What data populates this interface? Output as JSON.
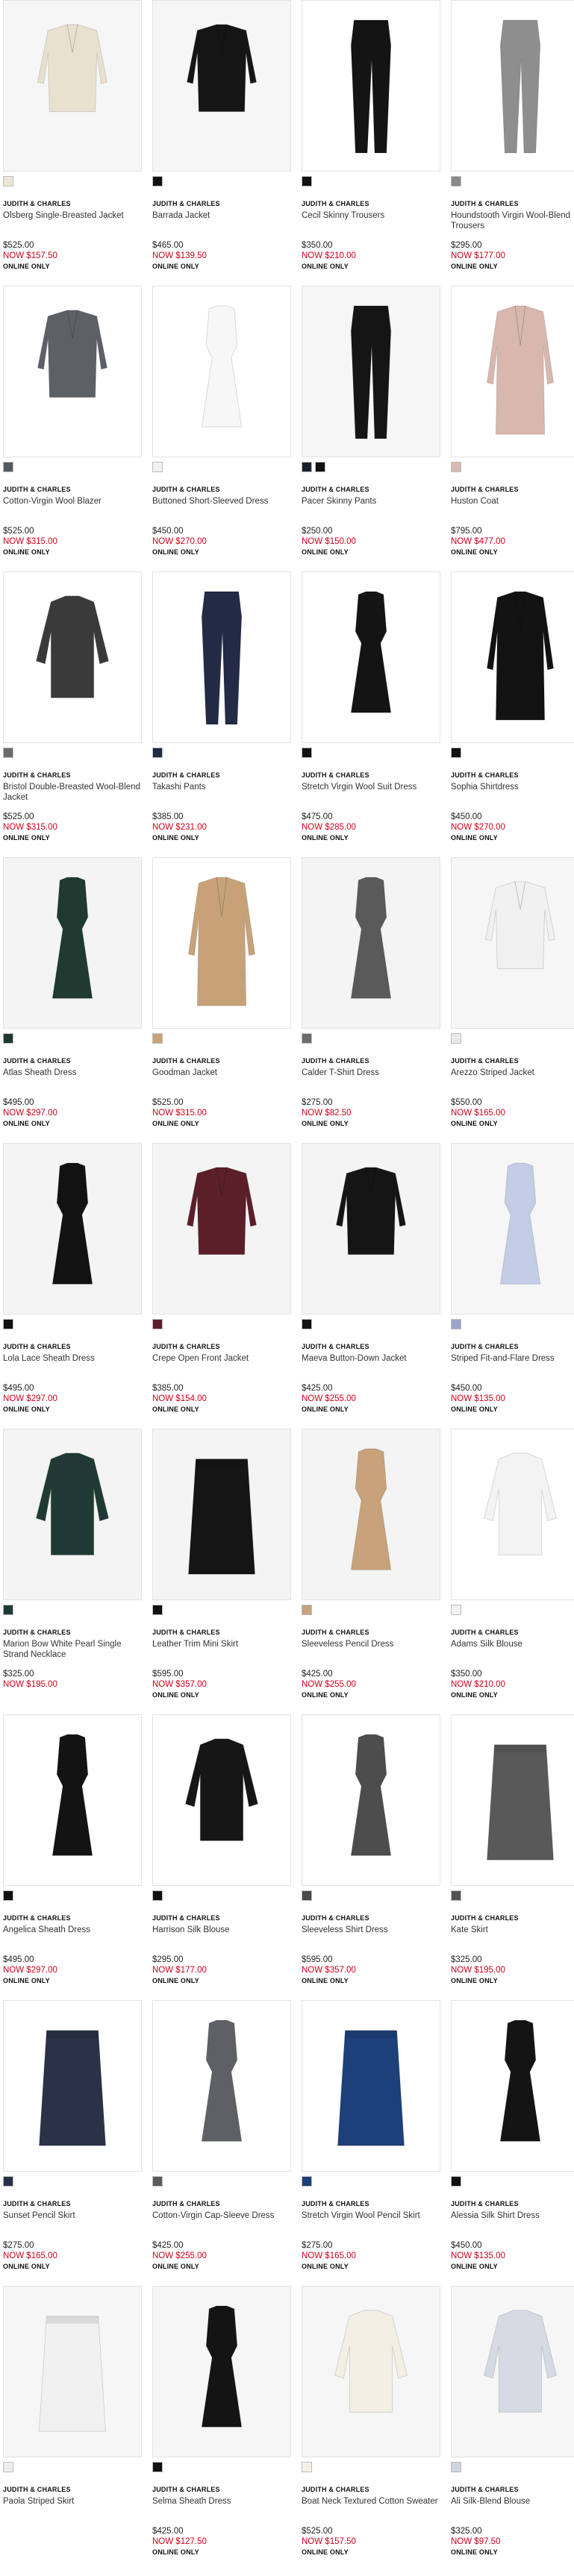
{
  "products": [
    {
      "brand": "JUDITH & CHARLES",
      "name": "Olsberg Single-Breasted Jacket",
      "was": "$525.00",
      "now": "NOW  $157.50",
      "online": "ONLINE ONLY",
      "swatches": [
        "#ece6d4"
      ],
      "garment": "jacket",
      "color": "#e9e1cf",
      "bg": "#f6f6f6"
    },
    {
      "brand": "JUDITH & CHARLES",
      "name": "Barrada Jacket",
      "was": "$465.00",
      "now": "NOW  $139.50",
      "online": "ONLINE ONLY",
      "swatches": [
        "#111111"
      ],
      "garment": "jacket",
      "color": "#151515",
      "bg": "#f6f6f6"
    },
    {
      "brand": "JUDITH & CHARLES",
      "name": "Cecil Skinny Trousers",
      "was": "$350.00",
      "now": "NOW  $210.00",
      "online": "ONLINE ONLY",
      "swatches": [
        "#111111"
      ],
      "garment": "pants",
      "color": "#141414",
      "bg": "#ffffff"
    },
    {
      "brand": "JUDITH & CHARLES",
      "name": "Houndstooth Virgin Wool-Blend Trousers",
      "was": "$295.00",
      "now": "NOW  $177.00",
      "online": "ONLINE ONLY",
      "swatches": [
        "#8a8a8a"
      ],
      "garment": "pants",
      "color": "#8e8e8e",
      "bg": "#ffffff"
    },
    {
      "brand": "JUDITH & CHARLES",
      "name": "Cotton-Virgin Wool Blazer",
      "was": "$525.00",
      "now": "NOW  $315.00",
      "online": "ONLINE ONLY",
      "swatches": [
        "#55595e"
      ],
      "garment": "jacket",
      "color": "#5d6167",
      "bg": "#ffffff"
    },
    {
      "brand": "JUDITH & CHARLES",
      "name": "Buttoned Short-Sleeved Dress",
      "was": "$450.00",
      "now": "NOW  $270.00",
      "online": "ONLINE ONLY",
      "swatches": [
        "#f2f2f2"
      ],
      "garment": "dress",
      "color": "#f7f7f7",
      "bg": "#ffffff"
    },
    {
      "brand": "JUDITH & CHARLES",
      "name": "Pacer Skinny Pants",
      "was": "$250.00",
      "now": "NOW  $150.00",
      "online": "ONLINE ONLY",
      "swatches": [
        "#1a1f2e",
        "#111111"
      ],
      "garment": "pants",
      "color": "#151515",
      "bg": "#f6f6f6"
    },
    {
      "brand": "JUDITH & CHARLES",
      "name": "Huston Coat",
      "was": "$795.00",
      "now": "NOW  $477.00",
      "online": "ONLINE ONLY",
      "swatches": [
        "#d9b9b2"
      ],
      "garment": "coat",
      "color": "#d8b7ae",
      "bg": "#ffffff"
    },
    {
      "brand": "JUDITH & CHARLES",
      "name": "Bristol Double-Breasted Wool-Blend Jacket",
      "was": "$525.00",
      "now": "NOW  $315.00",
      "online": "ONLINE ONLY",
      "swatches": [
        "#6a6a6a"
      ],
      "garment": "top",
      "color": "#3a3a3a",
      "bg": "#ffffff"
    },
    {
      "brand": "JUDITH & CHARLES",
      "name": "Takashi Pants",
      "was": "$385.00",
      "now": "NOW  $231.00",
      "online": "ONLINE ONLY",
      "swatches": [
        "#232a45"
      ],
      "garment": "pants",
      "color": "#232a45",
      "bg": "#ffffff"
    },
    {
      "brand": "JUDITH & CHARLES",
      "name": "Stretch Virgin Wool Suit Dress",
      "was": "$475.00",
      "now": "NOW  $285.00",
      "online": "ONLINE ONLY",
      "swatches": [
        "#111111"
      ],
      "garment": "dress",
      "color": "#141414",
      "bg": "#ffffff"
    },
    {
      "brand": "JUDITH & CHARLES",
      "name": "Sophia Shirtdress",
      "was": "$450.00",
      "now": "NOW  $270.00",
      "online": "ONLINE ONLY",
      "swatches": [
        "#111111"
      ],
      "garment": "coat",
      "color": "#121212",
      "bg": "#ffffff"
    },
    {
      "brand": "JUDITH & CHARLES",
      "name": "Atlas Sheath Dress",
      "was": "$495.00",
      "now": "NOW  $297.00",
      "online": "ONLINE ONLY",
      "swatches": [
        "#1f3a30"
      ],
      "garment": "dress",
      "color": "#1f3a30",
      "bg": "#f4f4f4"
    },
    {
      "brand": "JUDITH & CHARLES",
      "name": "Goodman Jacket",
      "was": "$525.00",
      "now": "NOW  $315.00",
      "online": "ONLINE ONLY",
      "swatches": [
        "#c8a27a"
      ],
      "garment": "coat",
      "color": "#c7a279",
      "bg": "#ffffff"
    },
    {
      "brand": "JUDITH & CHARLES",
      "name": "Calder T-Shirt Dress",
      "was": "$275.00",
      "now": "NOW  $82.50",
      "online": "ONLINE ONLY",
      "swatches": [
        "#6c6c6c"
      ],
      "garment": "dress",
      "color": "#5a5a5a",
      "bg": "#f4f4f4"
    },
    {
      "brand": "JUDITH & CHARLES",
      "name": "Arezzo Striped Jacket",
      "was": "$550.00",
      "now": "NOW  $165.00",
      "online": "ONLINE ONLY",
      "swatches": [
        "#e8e8e8"
      ],
      "garment": "jacket",
      "color": "#f1f1f1",
      "bg": "#f6f6f6"
    },
    {
      "brand": "JUDITH & CHARLES",
      "name": "Lola Lace Sheath Dress",
      "was": "$495.00",
      "now": "NOW  $297.00",
      "online": "ONLINE ONLY",
      "swatches": [
        "#111111"
      ],
      "garment": "dress",
      "color": "#121212",
      "bg": "#f4f4f4"
    },
    {
      "brand": "JUDITH & CHARLES",
      "name": "Crepe Open Front Jacket",
      "was": "$385.00",
      "now": "NOW  $154.00",
      "online": "ONLINE ONLY",
      "swatches": [
        "#5b1f2a"
      ],
      "garment": "jacket",
      "color": "#5b1f2a",
      "bg": "#f4f4f4"
    },
    {
      "brand": "JUDITH & CHARLES",
      "name": "Maeva Button-Down Jacket",
      "was": "$425.00",
      "now": "NOW  $255.00",
      "online": "ONLINE ONLY",
      "swatches": [
        "#111111"
      ],
      "garment": "jacket",
      "color": "#151515",
      "bg": "#f4f4f4"
    },
    {
      "brand": "JUDITH & CHARLES",
      "name": "Striped Fit-and-Flare Dress",
      "was": "$450.00",
      "now": "NOW  $135.00",
      "online": "ONLINE ONLY",
      "swatches": [
        "#9aa6c9"
      ],
      "garment": "dress",
      "color": "#c3cde6",
      "bg": "#f6f6f6"
    },
    {
      "brand": "JUDITH & CHARLES",
      "name": "Marion Bow White Pearl Single Strand Necklace",
      "was": "$325.00",
      "now": "NOW  $195.00",
      "online": "",
      "swatches": [
        "#1f3a34"
      ],
      "garment": "top",
      "color": "#1f3a34",
      "bg": "#f4f4f4"
    },
    {
      "brand": "JUDITH & CHARLES",
      "name": "Leather Trim Mini Skirt",
      "was": "$595.00",
      "now": "NOW  $357.00",
      "online": "ONLINE ONLY",
      "swatches": [
        "#111111"
      ],
      "garment": "skirt",
      "color": "#151515",
      "bg": "#f4f4f4"
    },
    {
      "brand": "JUDITH & CHARLES",
      "name": "Sleeveless Pencil Dress",
      "was": "$425.00",
      "now": "NOW  $255.00",
      "online": "ONLINE ONLY",
      "swatches": [
        "#c8a27a"
      ],
      "garment": "dress",
      "color": "#c8a27a",
      "bg": "#f4f4f4"
    },
    {
      "brand": "JUDITH & CHARLES",
      "name": "Adams Silk Blouse",
      "was": "$350.00",
      "now": "NOW  $210.00",
      "online": "ONLINE ONLY",
      "swatches": [
        "#f2f2f2"
      ],
      "garment": "top",
      "color": "#f3f3f3",
      "bg": "#ffffff"
    },
    {
      "brand": "JUDITH & CHARLES",
      "name": "Angelica Sheath Dress",
      "was": "$495.00",
      "now": "NOW  $297.00",
      "online": "ONLINE ONLY",
      "swatches": [
        "#111111"
      ],
      "garment": "dress",
      "color": "#131313",
      "bg": "#ffffff"
    },
    {
      "brand": "JUDITH & CHARLES",
      "name": "Harrison Silk Blouse",
      "was": "$295.00",
      "now": "NOW  $177.00",
      "online": "ONLINE ONLY",
      "swatches": [
        "#111111"
      ],
      "garment": "top",
      "color": "#161616",
      "bg": "#ffffff"
    },
    {
      "brand": "JUDITH & CHARLES",
      "name": "Sleeveless Shirt Dress",
      "was": "$595.00",
      "now": "NOW  $357.00",
      "online": "ONLINE ONLY",
      "swatches": [
        "#4a4a4a"
      ],
      "garment": "dress",
      "color": "#4d4d4d",
      "bg": "#ffffff"
    },
    {
      "brand": "JUDITH & CHARLES",
      "name": "Kate Skirt",
      "was": "$325.00",
      "now": "NOW  $195.00",
      "online": "ONLINE ONLY",
      "swatches": [
        "#555555"
      ],
      "garment": "skirt",
      "color": "#595959",
      "bg": "#ffffff"
    },
    {
      "brand": "JUDITH & CHARLES",
      "name": "Sunset Pencil Skirt",
      "was": "$275.00",
      "now": "NOW  $165.00",
      "online": "ONLINE ONLY",
      "swatches": [
        "#2a3045"
      ],
      "garment": "skirt",
      "color": "#2b3146",
      "bg": "#ffffff"
    },
    {
      "brand": "JUDITH & CHARLES",
      "name": "Cotton-Virgin Cap-Sleeve Dress",
      "was": "$425.00",
      "now": "NOW  $255.00",
      "online": "ONLINE ONLY",
      "swatches": [
        "#5a5a5a"
      ],
      "garment": "dress",
      "color": "#5e6066",
      "bg": "#ffffff"
    },
    {
      "brand": "JUDITH & CHARLES",
      "name": "Stretch Virgin Wool Pencil Skirt",
      "was": "$275.00",
      "now": "NOW  $165.00",
      "online": "ONLINE ONLY",
      "swatches": [
        "#1d3f7a"
      ],
      "garment": "skirt",
      "color": "#1d3f7a",
      "bg": "#ffffff"
    },
    {
      "brand": "JUDITH & CHARLES",
      "name": "Alessia Silk Shirt Dress",
      "was": "$450.00",
      "now": "NOW  $135.00",
      "online": "ONLINE ONLY",
      "swatches": [
        "#111111"
      ],
      "garment": "dress",
      "color": "#141414",
      "bg": "#ffffff"
    },
    {
      "brand": "JUDITH & CHARLES",
      "name": "Paola Striped Skirt",
      "was": "",
      "now": "",
      "online": "",
      "swatches": [
        "#eeeeee"
      ],
      "garment": "skirt",
      "color": "#f1f1f1",
      "bg": "#f6f6f6"
    },
    {
      "brand": "JUDITH & CHARLES",
      "name": "Selma Sheath Dress",
      "was": "$425.00",
      "now": "NOW  $127.50",
      "online": "ONLINE ONLY",
      "swatches": [
        "#111111"
      ],
      "garment": "dress",
      "color": "#141414",
      "bg": "#f6f6f6"
    },
    {
      "brand": "JUDITH & CHARLES",
      "name": "Boat Neck Textured Cotton Sweater",
      "was": "$525.00",
      "now": "NOW  $157.50",
      "online": "ONLINE ONLY",
      "swatches": [
        "#f5f1e8"
      ],
      "garment": "top",
      "color": "#f4efe4",
      "bg": "#f6f6f6"
    },
    {
      "brand": "JUDITH & CHARLES",
      "name": "Ali Silk-Blend Blouse",
      "was": "$325.00",
      "now": "NOW  $97.50",
      "online": "ONLINE ONLY",
      "swatches": [
        "#cfd3dc"
      ],
      "garment": "top",
      "color": "#d6dae3",
      "bg": "#f6f6f6"
    }
  ]
}
